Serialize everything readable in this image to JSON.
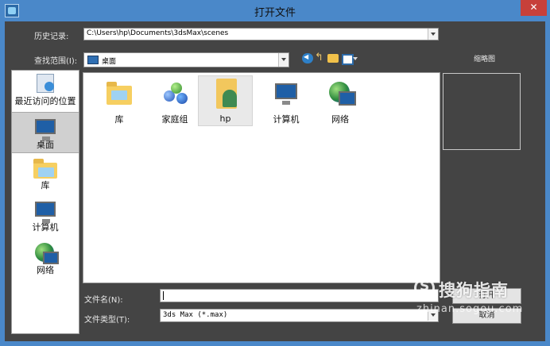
{
  "window": {
    "title": "打开文件",
    "close_glyph": "✕"
  },
  "history": {
    "label": "历史记录:",
    "value": "C:\\Users\\hp\\Documents\\3dsMax\\scenes"
  },
  "look_in": {
    "label": "查找范围(I):",
    "value": "桌面",
    "icon": "desktop-icon"
  },
  "toolbar": {
    "icons": [
      "back-icon",
      "up-folder-icon",
      "new-folder-icon",
      "view-menu-icon"
    ]
  },
  "thumbnail": {
    "label": "缩略图"
  },
  "places": [
    {
      "label": "最近访问的位置",
      "icon": "recent-places-icon"
    },
    {
      "label": "桌面",
      "icon": "desktop-icon",
      "selected": true
    },
    {
      "label": "库",
      "icon": "library-icon"
    },
    {
      "label": "计算机",
      "icon": "computer-icon"
    },
    {
      "label": "网络",
      "icon": "network-icon"
    }
  ],
  "files": [
    {
      "name": "库",
      "icon": "library-icon"
    },
    {
      "name": "家庭组",
      "icon": "homegroup-icon"
    },
    {
      "name": "hp",
      "icon": "user-folder-icon",
      "selected": true
    },
    {
      "name": "计算机",
      "icon": "computer-icon"
    },
    {
      "name": "网络",
      "icon": "network-icon"
    }
  ],
  "file_name": {
    "label": "文件名(N):",
    "value": ""
  },
  "file_type": {
    "label": "文件类型(T):",
    "value": "3ds Max (*.max)"
  },
  "buttons": {
    "open": "打开",
    "cancel": "取消"
  },
  "watermark": {
    "brand": "搜狗指南",
    "url": "zhinan.sogou.com"
  }
}
